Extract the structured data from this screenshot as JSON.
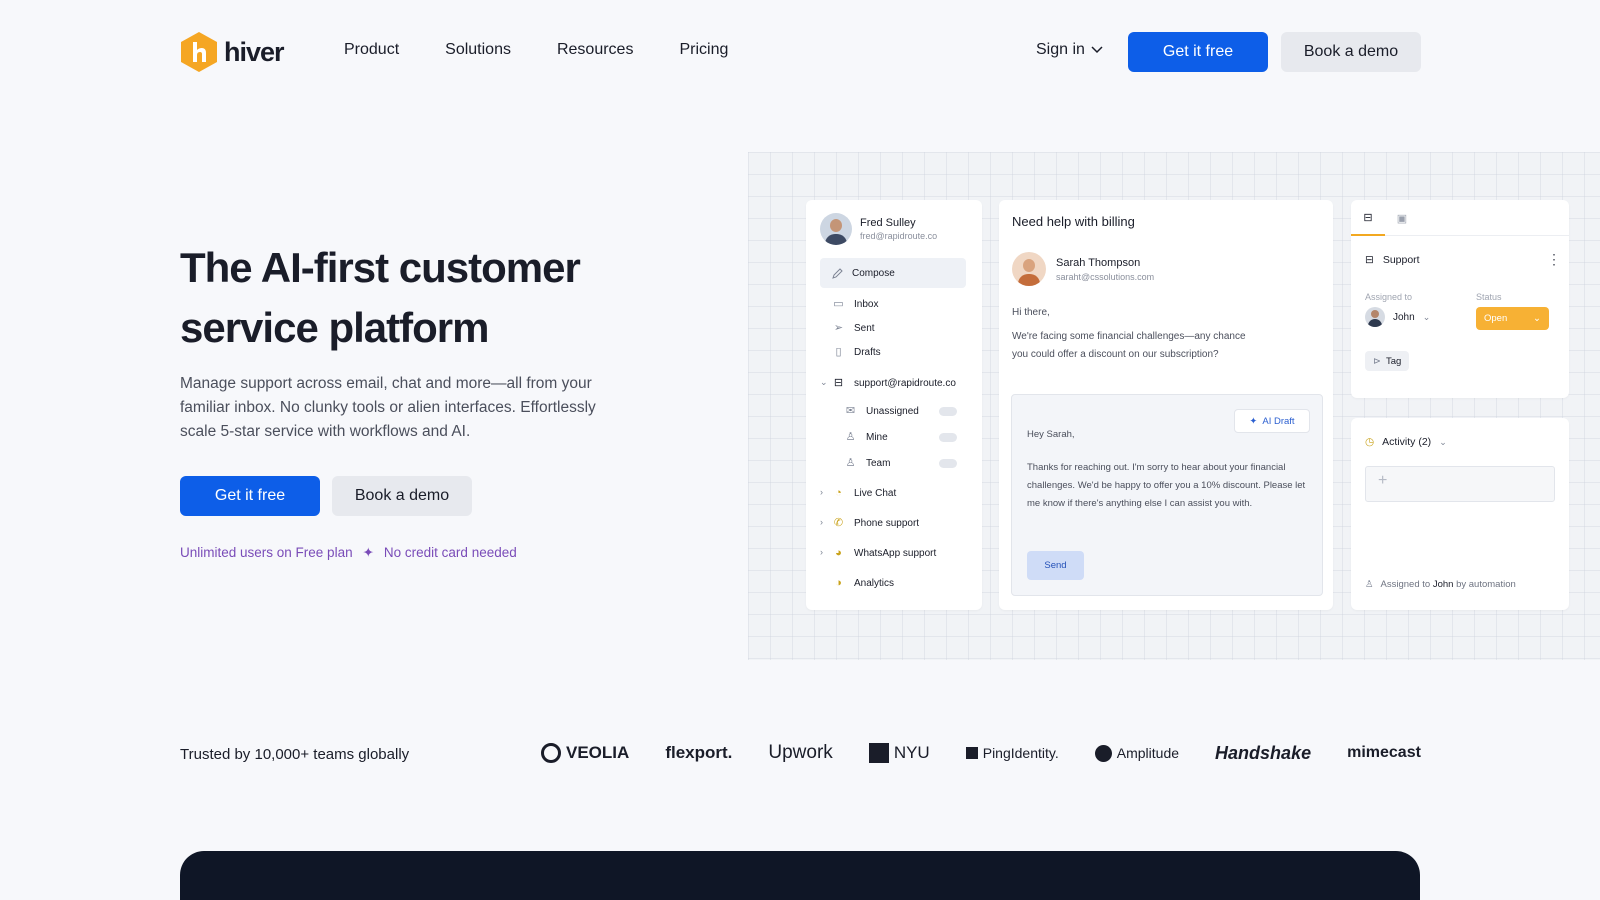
{
  "nav": {
    "logo_text": "hiver",
    "links": [
      "Product",
      "Solutions",
      "Resources",
      "Pricing"
    ],
    "signin": "Sign in",
    "get_free": "Get it free",
    "book_demo": "Book a demo"
  },
  "hero": {
    "title": "The AI-first customer service platform",
    "subtitle": "Manage support across email, chat and more—all from your familiar inbox. No clunky tools or alien interfaces. Effortlessly scale 5-star service with workflows and AI.",
    "cta_primary": "Get it free",
    "cta_secondary": "Book a demo",
    "note_a": "Unlimited users on Free plan",
    "note_sep": "✦",
    "note_b": "No credit card needed"
  },
  "mock": {
    "user": {
      "name": "Fred Sulley",
      "email": "fred@rapidroute.co"
    },
    "compose": "Compose",
    "folders": [
      "Inbox",
      "Sent",
      "Drafts"
    ],
    "shared_inbox": "support@rapidroute.co",
    "sub_folders": [
      "Unassigned",
      "Mine",
      "Team"
    ],
    "channels": [
      "Live Chat",
      "Phone support",
      "WhatsApp support"
    ],
    "analytics": "Analytics",
    "thread": {
      "subject": "Need help with billing",
      "sender_name": "Sarah Thompson",
      "sender_email": "saraht@cssolutions.com",
      "greeting": "Hi there,",
      "body_line1": "We're facing some financial challenges—any chance",
      "body_line2": "you could offer a discount on our subscription?"
    },
    "draft": {
      "ai_label": "AI Draft",
      "greeting": "Hey Sarah,",
      "body": "Thanks for reaching out. I'm sorry to hear about your financial challenges. We'd be happy to offer you a 10% discount. Please let me know if there's anything else I can assist you with.",
      "send": "Send"
    },
    "details": {
      "inbox": "Support",
      "assigned_label": "Assigned to",
      "assignee": "John",
      "status_label": "Status",
      "status": "Open",
      "tag": "Tag"
    },
    "activity": {
      "title": "Activity (2)",
      "add": "+",
      "auto_prefix": "Assigned to",
      "auto_name": "John",
      "auto_suffix": "by automation"
    },
    "colors": {
      "accent": "#0d5ee8",
      "status": "#f7b134",
      "tab_underline": "#f2a820"
    }
  },
  "trusted": {
    "label": "Trusted by 10,000+ teams globally",
    "brands": [
      "VEOLIA",
      "flexport.",
      "Upwork",
      "NYU",
      "PingIdentity.",
      "Amplitude",
      "Handshake",
      "mimecast"
    ]
  }
}
